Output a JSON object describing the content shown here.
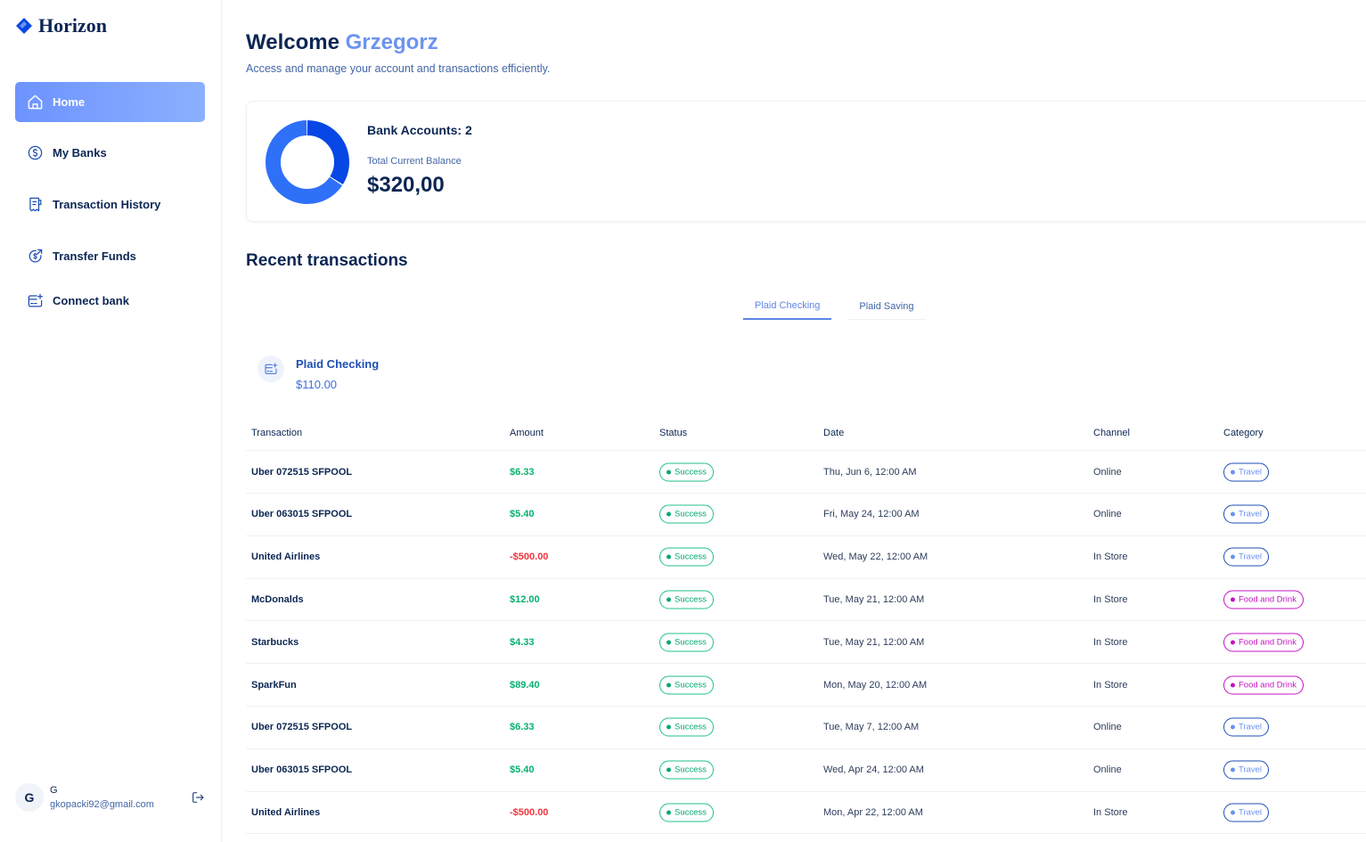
{
  "app": {
    "name": "Horizon"
  },
  "sidebar": {
    "items": [
      {
        "label": "Home",
        "icon": "home-icon",
        "active": true
      },
      {
        "label": "My Banks",
        "icon": "dollar-circle-icon",
        "active": false
      },
      {
        "label": "Transaction History",
        "icon": "receipt-icon",
        "active": false
      },
      {
        "label": "Transfer Funds",
        "icon": "money-send-icon",
        "active": false
      },
      {
        "label": "Connect bank",
        "icon": "card-add-icon",
        "active": false
      }
    ],
    "user": {
      "initial": "G",
      "name": "G",
      "email": "gkopacki92@gmail.com"
    }
  },
  "header": {
    "welcome": "Welcome",
    "user_name": "Grzegorz",
    "subtitle": "Access and manage your account and transactions efficiently."
  },
  "balance": {
    "accounts_label": "Bank Accounts: 2",
    "total_label": "Total Current Balance",
    "total_value": "$320,00",
    "segments": [
      {
        "name": "Plaid Checking",
        "value": 110,
        "color": "#0747e6"
      },
      {
        "name": "Plaid Saving",
        "value": 210,
        "color": "#2f70f9"
      }
    ]
  },
  "recent": {
    "title": "Recent transactions",
    "tabs": [
      {
        "label": "Plaid Checking",
        "active": true
      },
      {
        "label": "Plaid Saving",
        "active": false
      }
    ],
    "bank": {
      "name": "Plaid Checking",
      "balance": "$110.00"
    },
    "columns": [
      "Transaction",
      "Amount",
      "Status",
      "Date",
      "Channel",
      "Category"
    ],
    "rows": [
      {
        "name": "Uber 072515 SFPOOL",
        "amount": "$6.33",
        "negative": false,
        "status": "Success",
        "date": "Thu, Jun 6, 12:00 AM",
        "channel": "Online",
        "category": "Travel"
      },
      {
        "name": "Uber 063015 SFPOOL",
        "amount": "$5.40",
        "negative": false,
        "status": "Success",
        "date": "Fri, May 24, 12:00 AM",
        "channel": "Online",
        "category": "Travel"
      },
      {
        "name": "United Airlines",
        "amount": "-$500.00",
        "negative": true,
        "status": "Success",
        "date": "Wed, May 22, 12:00 AM",
        "channel": "In Store",
        "category": "Travel"
      },
      {
        "name": "McDonalds",
        "amount": "$12.00",
        "negative": false,
        "status": "Success",
        "date": "Tue, May 21, 12:00 AM",
        "channel": "In Store",
        "category": "Food and Drink"
      },
      {
        "name": "Starbucks",
        "amount": "$4.33",
        "negative": false,
        "status": "Success",
        "date": "Tue, May 21, 12:00 AM",
        "channel": "In Store",
        "category": "Food and Drink"
      },
      {
        "name": "SparkFun",
        "amount": "$89.40",
        "negative": false,
        "status": "Success",
        "date": "Mon, May 20, 12:00 AM",
        "channel": "In Store",
        "category": "Food and Drink"
      },
      {
        "name": "Uber 072515 SFPOOL",
        "amount": "$6.33",
        "negative": false,
        "status": "Success",
        "date": "Tue, May 7, 12:00 AM",
        "channel": "Online",
        "category": "Travel"
      },
      {
        "name": "Uber 063015 SFPOOL",
        "amount": "$5.40",
        "negative": false,
        "status": "Success",
        "date": "Wed, Apr 24, 12:00 AM",
        "channel": "Online",
        "category": "Travel"
      },
      {
        "name": "United Airlines",
        "amount": "-$500.00",
        "negative": true,
        "status": "Success",
        "date": "Mon, Apr 22, 12:00 AM",
        "channel": "In Store",
        "category": "Travel"
      }
    ]
  }
}
